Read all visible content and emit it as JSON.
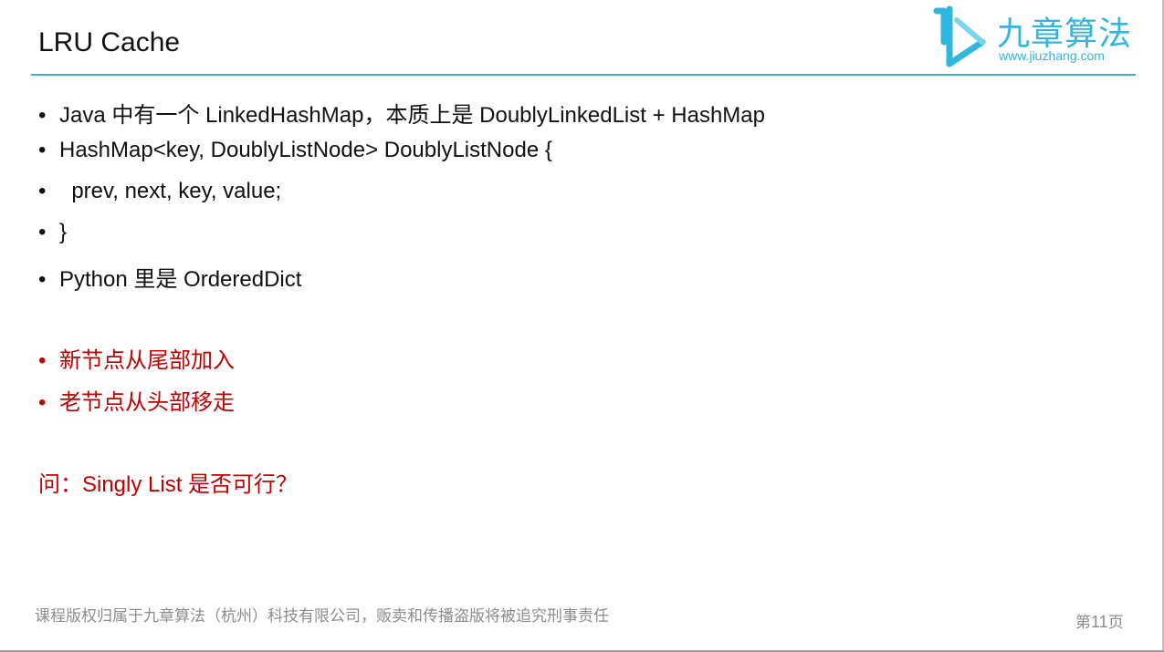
{
  "slide": {
    "title": "LRU Cache",
    "accent_color": "#35b2dd",
    "logo": {
      "icon": "jiuzhang-logo-icon",
      "cn_text": "九章算法",
      "url": "www.jiuzhang.com"
    },
    "bullets": [
      {
        "marker": "•",
        "text": "Java 中有一个 LinkedHashMap，本质上是 DoublyLinkedList + HashMap"
      },
      {
        "marker": "•",
        "text": "HashMap<key, DoublyListNode> DoublyListNode {"
      },
      {
        "marker": "•",
        "text": "  prev, next, key, value;"
      },
      {
        "marker": "•",
        "text": "}"
      },
      {
        "marker": "•",
        "text": "Python 里是 OrderedDict"
      }
    ],
    "red_bullets": [
      {
        "marker": "•",
        "text": "新节点从尾部加入"
      },
      {
        "marker": "•",
        "text": "老节点从头部移走"
      }
    ],
    "question": "问：Singly List 是否可行？",
    "question_color": "#c00000",
    "footer": "课程版权归属于九章算法（杭州）科技有限公司，贩卖和传播盗版将被追究刑事责任",
    "page": {
      "prefix": "第",
      "number": "11",
      "suffix": "页"
    }
  }
}
